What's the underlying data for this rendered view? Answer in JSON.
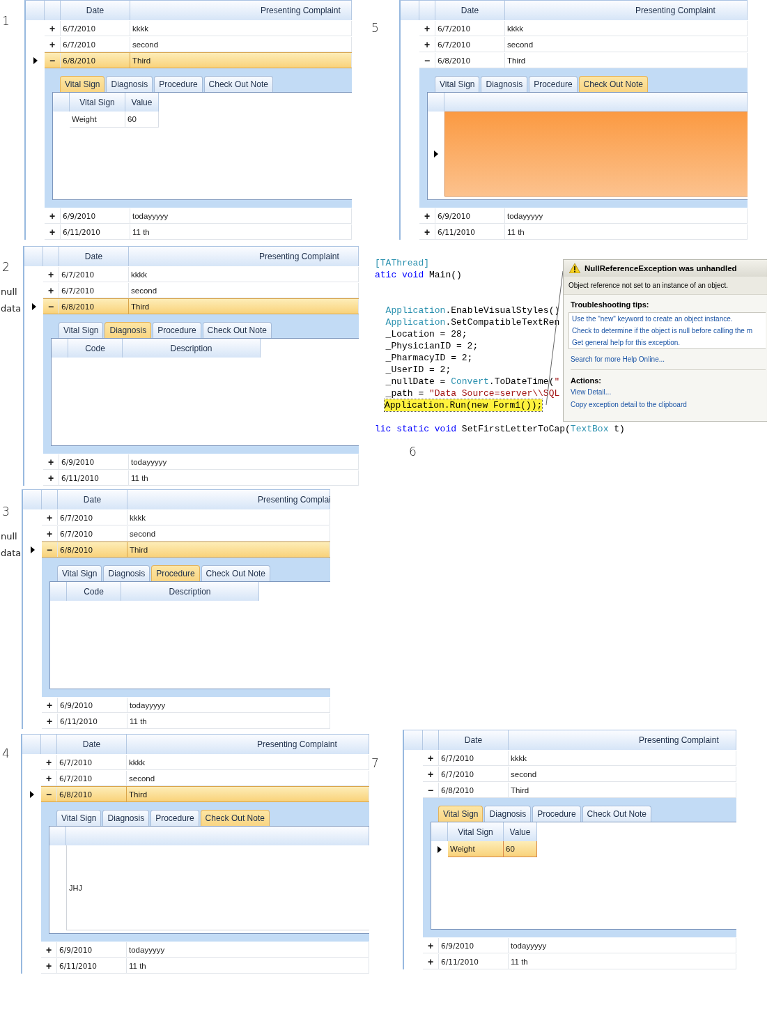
{
  "screens": [
    {
      "kind": "grid",
      "number": "1",
      "columns": [
        "Date",
        "Presenting Complaint"
      ],
      "rows": [
        {
          "toggle": "+",
          "date": "6/7/2010",
          "complaint": "kkkk",
          "selected": false
        },
        {
          "toggle": "+",
          "date": "6/7/2010",
          "complaint": "second",
          "selected": false
        },
        {
          "toggle": "−",
          "date": "6/8/2010",
          "complaint": "Third",
          "selected": true,
          "detail": {
            "tabs": [
              {
                "label": "Vital Sign",
                "selected": true
              },
              {
                "label": "Diagnosis",
                "selected": false
              },
              {
                "label": "Procedure",
                "selected": false
              },
              {
                "label": "Check Out Note",
                "selected": false
              }
            ],
            "content": {
              "kind": "vitals",
              "columns": [
                "Vital Sign",
                "Value"
              ],
              "rows": [
                {
                  "cells": [
                    "Weight",
                    "60"
                  ],
                  "selected": false
                }
              ]
            }
          }
        },
        {
          "toggle": "+",
          "date": "6/9/2010",
          "complaint": "todayyyyy",
          "selected": false
        },
        {
          "toggle": "+",
          "date": "6/11/2010",
          "complaint": "11 th",
          "selected": false
        }
      ]
    },
    {
      "kind": "grid",
      "number": "2",
      "note": "null data",
      "columns": [
        "Date",
        "Presenting Complaint"
      ],
      "rows": [
        {
          "toggle": "+",
          "date": "6/7/2010",
          "complaint": "kkkk",
          "selected": false
        },
        {
          "toggle": "+",
          "date": "6/7/2010",
          "complaint": "second",
          "selected": false
        },
        {
          "toggle": "−",
          "date": "6/8/2010",
          "complaint": "Third",
          "selected": true,
          "detail": {
            "tabs": [
              {
                "label": "Vital Sign",
                "selected": false
              },
              {
                "label": "Diagnosis",
                "selected": true
              },
              {
                "label": "Procedure",
                "selected": false
              },
              {
                "label": "Check Out Note",
                "selected": false
              }
            ],
            "content": {
              "kind": "codes",
              "columns": [
                "Code",
                "Description"
              ]
            }
          }
        },
        {
          "toggle": "+",
          "date": "6/9/2010",
          "complaint": "todayyyyy",
          "selected": false
        },
        {
          "toggle": "+",
          "date": "6/11/2010",
          "complaint": "11 th",
          "selected": false
        }
      ]
    },
    {
      "kind": "grid",
      "number": "3",
      "note": "null data",
      "columns": [
        "Date",
        "Presenting Complai"
      ],
      "rows": [
        {
          "toggle": "+",
          "date": "6/7/2010",
          "complaint": "kkkk",
          "selected": false
        },
        {
          "toggle": "+",
          "date": "6/7/2010",
          "complaint": "second",
          "selected": false
        },
        {
          "toggle": "−",
          "date": "6/8/2010",
          "complaint": "Third",
          "selected": true,
          "detail": {
            "tabs": [
              {
                "label": "Vital Sign",
                "selected": false
              },
              {
                "label": "Diagnosis",
                "selected": false
              },
              {
                "label": "Procedure",
                "selected": true
              },
              {
                "label": "Check Out Note",
                "selected": false
              }
            ],
            "content": {
              "kind": "codes",
              "columns": [
                "Code",
                "Description"
              ]
            }
          }
        },
        {
          "toggle": "+",
          "date": "6/9/2010",
          "complaint": "todayyyyy",
          "selected": false
        },
        {
          "toggle": "+",
          "date": "6/11/2010",
          "complaint": "11 th",
          "selected": false
        }
      ]
    },
    {
      "kind": "grid",
      "number": "4",
      "columns": [
        "Date",
        "Presenting Complaint"
      ],
      "rows": [
        {
          "toggle": "+",
          "date": "6/7/2010",
          "complaint": "kkkk",
          "selected": false
        },
        {
          "toggle": "+",
          "date": "6/7/2010",
          "complaint": "second",
          "selected": false
        },
        {
          "toggle": "−",
          "date": "6/8/2010",
          "complaint": "Third",
          "selected": true,
          "detail": {
            "tabs": [
              {
                "label": "Vital Sign",
                "selected": false
              },
              {
                "label": "Diagnosis",
                "selected": false
              },
              {
                "label": "Procedure",
                "selected": false
              },
              {
                "label": "Check Out Note",
                "selected": true
              }
            ],
            "content": {
              "kind": "note",
              "rows": [
                {
                  "text": "JHJ",
                  "selected": false
                }
              ]
            }
          }
        },
        {
          "toggle": "+",
          "date": "6/9/2010",
          "complaint": "todayyyyy",
          "selected": false
        },
        {
          "toggle": "+",
          "date": "6/11/2010",
          "complaint": "11 th",
          "selected": false
        }
      ]
    },
    {
      "kind": "grid",
      "number": "5",
      "columns": [
        "Date",
        "Presenting Complaint"
      ],
      "rows": [
        {
          "toggle": "+",
          "date": "6/7/2010",
          "complaint": "kkkk",
          "selected": false
        },
        {
          "toggle": "+",
          "date": "6/7/2010",
          "complaint": "second",
          "selected": false
        },
        {
          "toggle": "−",
          "date": "6/8/2010",
          "complaint": "Third",
          "selected": false,
          "detail": {
            "tabs": [
              {
                "label": "Vital Sign",
                "selected": false
              },
              {
                "label": "Diagnosis",
                "selected": false
              },
              {
                "label": "Procedure",
                "selected": false
              },
              {
                "label": "Check Out Note",
                "selected": true
              }
            ],
            "content": {
              "kind": "note",
              "rows": [
                {
                  "selected": true
                }
              ]
            }
          }
        },
        {
          "toggle": "+",
          "date": "6/9/2010",
          "complaint": "todayyyyy",
          "selected": false
        },
        {
          "toggle": "+",
          "date": "6/11/2010",
          "complaint": "11 th",
          "selected": false
        }
      ]
    },
    {
      "kind": "code",
      "number": "6",
      "lines": [
        {
          "kind": "code",
          "current": false,
          "tokens": [
            {
              "t": "[TAThread]",
              "kind": "type"
            }
          ]
        },
        {
          "kind": "code",
          "current": false,
          "tokens": [
            {
              "t": "atic void",
              "kind": "keyword"
            },
            {
              "t": " Main()",
              "kind": "plain"
            }
          ]
        },
        {
          "kind": "blank"
        },
        {
          "kind": "blank"
        },
        {
          "kind": "code",
          "current": false,
          "tokens": [
            {
              "t": "  Application",
              "kind": "type"
            },
            {
              "t": ".EnableVisualStyles()",
              "kind": "plain"
            }
          ]
        },
        {
          "kind": "code",
          "current": false,
          "tokens": [
            {
              "t": "  Application",
              "kind": "type"
            },
            {
              "t": ".SetCompatibleTextRen",
              "kind": "plain"
            }
          ]
        },
        {
          "kind": "code",
          "current": false,
          "tokens": [
            {
              "t": "  _Location = 28;",
              "kind": "plain"
            }
          ]
        },
        {
          "kind": "code",
          "current": false,
          "tokens": [
            {
              "t": "  _PhysicianID = 2;",
              "kind": "plain"
            }
          ]
        },
        {
          "kind": "code",
          "current": false,
          "tokens": [
            {
              "t": "  _PharmacyID = 2;",
              "kind": "plain"
            }
          ]
        },
        {
          "kind": "code",
          "current": false,
          "tokens": [
            {
              "t": "  _UserID = 2;",
              "kind": "plain"
            }
          ]
        },
        {
          "kind": "code",
          "current": false,
          "tokens": [
            {
              "t": "  _nullDate = ",
              "kind": "plain"
            },
            {
              "t": "Convert",
              "kind": "type"
            },
            {
              "t": ".ToDateTime(",
              "kind": "plain"
            },
            {
              "t": "\"",
              "kind": "string"
            }
          ]
        },
        {
          "kind": "code",
          "current": false,
          "tokens": [
            {
              "t": "  _path = ",
              "kind": "plain"
            },
            {
              "t": "\"Data Source=server\\\\SQL",
              "kind": "string"
            }
          ]
        },
        {
          "kind": "code",
          "current": true,
          "tokens": [
            {
              "t": "Application.Run(new Form1());",
              "kind": "plain"
            }
          ]
        },
        {
          "kind": "blank"
        },
        {
          "kind": "code",
          "current": false,
          "tokens": [
            {
              "t": "lic static void",
              "kind": "keyword"
            },
            {
              "t": " SetFirstLetterToCap(",
              "kind": "plain"
            },
            {
              "t": "TextBox",
              "kind": "type"
            },
            {
              "t": " t)",
              "kind": "plain"
            }
          ]
        }
      ],
      "exception": {
        "title": "NullReferenceException was unhandled",
        "message": "Object reference not set to an instance of an object.",
        "tips_heading": "Troubleshooting tips:",
        "tips": [
          "Use the \"new\" keyword to create an object instance.",
          "Check to determine if the object is null before calling the m",
          "Get general help for this exception."
        ],
        "help_link": "Search for more Help Online...",
        "actions_heading": "Actions:",
        "actions": [
          "View Detail...",
          "Copy exception detail to the clipboard"
        ]
      }
    },
    {
      "kind": "grid",
      "number": "7",
      "columns": [
        "Date",
        "Presenting Complaint"
      ],
      "rows": [
        {
          "toggle": "+",
          "date": "6/7/2010",
          "complaint": "kkkk",
          "selected": false
        },
        {
          "toggle": "+",
          "date": "6/7/2010",
          "complaint": "second",
          "selected": false
        },
        {
          "toggle": "−",
          "date": "6/8/2010",
          "complaint": "Third",
          "selected": false,
          "detail": {
            "tabs": [
              {
                "label": "Vital Sign",
                "selected": true
              },
              {
                "label": "Diagnosis",
                "selected": false
              },
              {
                "label": "Procedure",
                "selected": false
              },
              {
                "label": "Check Out Note",
                "selected": false
              }
            ],
            "content": {
              "kind": "vitals",
              "columns": [
                "Vital Sign",
                "Value"
              ],
              "rows": [
                {
                  "cells": [
                    "Weight",
                    "60"
                  ],
                  "selected": true
                }
              ]
            }
          }
        },
        {
          "toggle": "+",
          "date": "6/9/2010",
          "complaint": "todayyyyy",
          "selected": false
        },
        {
          "toggle": "+",
          "date": "6/11/2010",
          "complaint": "11 th",
          "selected": false
        }
      ]
    }
  ]
}
